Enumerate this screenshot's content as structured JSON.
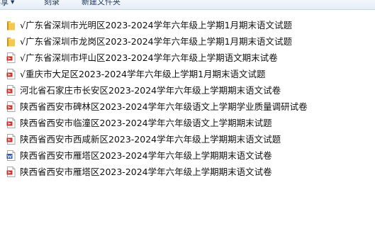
{
  "toolbar": {
    "items": [
      {
        "label": "共享",
        "has_menu": true
      },
      {
        "label": "刻录",
        "has_menu": false
      },
      {
        "label": "新建文件夹",
        "has_menu": false
      }
    ]
  },
  "colors": {
    "folder": "#f2c94c",
    "pdf": "#d0302a",
    "word": "#2b5aad"
  },
  "files": [
    {
      "name": "√广东省深圳市光明区2023-2024学年六年级上学期1月期末语文试题",
      "icon": "folder-icon"
    },
    {
      "name": "√广东省深圳市龙岗区2023-2024学年六年级上学期1月期末语文试题",
      "icon": "folder-icon"
    },
    {
      "name": "√广东省深圳市坪山区2023-2024学年六年级上学期语文期末试卷",
      "icon": "pdf-icon"
    },
    {
      "name": "√重庆市大足区2023-2024学年六年级上学期1月期末语文试题",
      "icon": "pdf-icon"
    },
    {
      "name": "河北省石家庄市长安区2023-2024学年六年级上学期期末语文试卷",
      "icon": "pdf-icon"
    },
    {
      "name": "陕西省西安市碑林区2023-2024学年六年级语文上学期学业质量调研试卷",
      "icon": "pdf-icon"
    },
    {
      "name": "陕西省西安市临潼区2023-2024学年六年级语文上学期期末试题",
      "icon": "pdf-icon"
    },
    {
      "name": "陕西省西安市西咸新区2023-2024学年六年级上学期期末语文试题",
      "icon": "pdf-icon"
    },
    {
      "name": "陕西省西安市雁塔区2023-2024学年六年级上学期期末语文试卷",
      "icon": "word-icon"
    },
    {
      "name": "陕西省西安市雁塔区2023-2024学年六年级上学期期末语文试卷",
      "icon": "pdf-icon"
    }
  ]
}
